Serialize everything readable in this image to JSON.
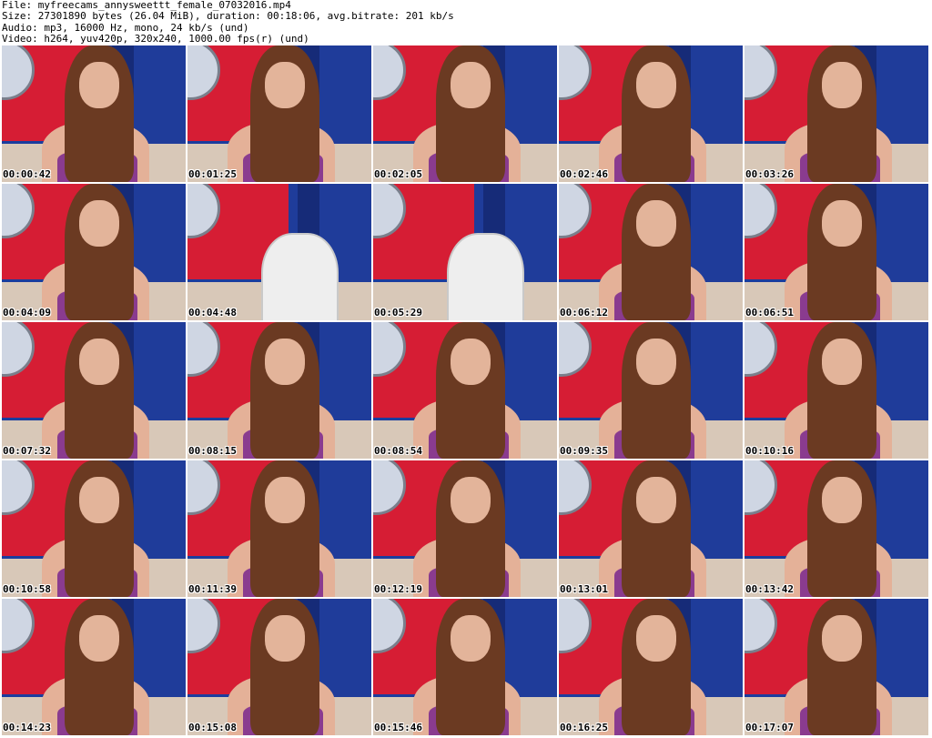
{
  "header": {
    "file": "File: myfreecams_annysweettt_female_07032016.mp4",
    "size": "Size: 27301890 bytes (26.04 MiB), duration: 00:18:06, avg.bitrate: 201 kb/s",
    "audio": "Audio: mp3, 16000 Hz, mono, 24 kb/s (und)",
    "video": "Video: h264, yuv420p, 320x240, 1000.00 fps(r) (und)"
  },
  "thumbnails": [
    {
      "timestamp": "00:00:42",
      "scene": "person"
    },
    {
      "timestamp": "00:01:25",
      "scene": "person"
    },
    {
      "timestamp": "00:02:05",
      "scene": "person"
    },
    {
      "timestamp": "00:02:46",
      "scene": "person"
    },
    {
      "timestamp": "00:03:26",
      "scene": "person"
    },
    {
      "timestamp": "00:04:09",
      "scene": "person"
    },
    {
      "timestamp": "00:04:48",
      "scene": "chair"
    },
    {
      "timestamp": "00:05:29",
      "scene": "chair"
    },
    {
      "timestamp": "00:06:12",
      "scene": "person"
    },
    {
      "timestamp": "00:06:51",
      "scene": "person"
    },
    {
      "timestamp": "00:07:32",
      "scene": "person"
    },
    {
      "timestamp": "00:08:15",
      "scene": "person"
    },
    {
      "timestamp": "00:08:54",
      "scene": "person"
    },
    {
      "timestamp": "00:09:35",
      "scene": "person"
    },
    {
      "timestamp": "00:10:16",
      "scene": "person"
    },
    {
      "timestamp": "00:10:58",
      "scene": "person"
    },
    {
      "timestamp": "00:11:39",
      "scene": "person"
    },
    {
      "timestamp": "00:12:19",
      "scene": "person"
    },
    {
      "timestamp": "00:13:01",
      "scene": "person"
    },
    {
      "timestamp": "00:13:42",
      "scene": "person"
    },
    {
      "timestamp": "00:14:23",
      "scene": "person"
    },
    {
      "timestamp": "00:15:08",
      "scene": "person"
    },
    {
      "timestamp": "00:15:46",
      "scene": "person"
    },
    {
      "timestamp": "00:16:25",
      "scene": "person"
    },
    {
      "timestamp": "00:17:07",
      "scene": "person"
    }
  ]
}
